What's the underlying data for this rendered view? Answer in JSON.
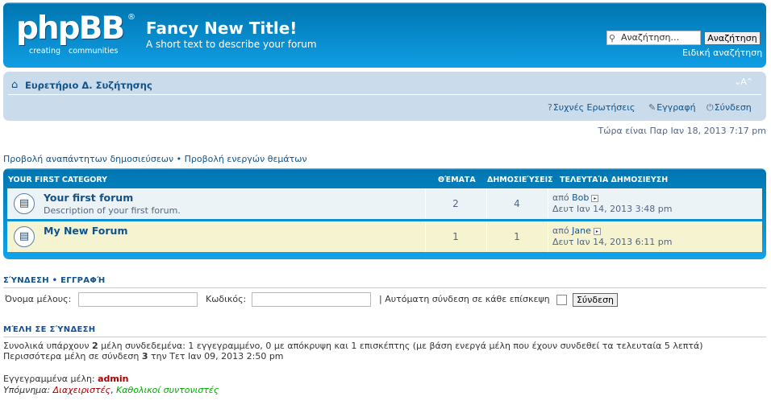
{
  "header": {
    "logo_word": "phpBB",
    "logo_reg": "®",
    "logo_tag_1": "creating",
    "logo_tag_2": "communities",
    "site_title": "Fancy New Title!",
    "site_description": "A short text to describe your forum",
    "search_placeholder": "Αναζήτηση…",
    "search_button": "Αναζήτηση",
    "advanced_search": "Ειδική αναζήτηση"
  },
  "navbar": {
    "breadcrumb": "Ευρετήριο Δ. Συζήτησης",
    "font_resize": "⌄A⌃",
    "faq": "Συχνές Ερωτήσεις",
    "register": "Εγγραφή",
    "login": "Σύνδεση"
  },
  "current_time": "Τώρα είναι Παρ Ιαν 18, 2013 7:17 pm",
  "quick_links": {
    "unanswered": "Προβολή αναπάντητων δημοσιεύσεων",
    "separator": "•",
    "active": "Προβολή ενεργών θεμάτων"
  },
  "forum_table": {
    "category": "YOUR FIRST CATEGORY",
    "col_topics": "ΘΈΜΑΤΑ",
    "col_posts": "ΔΗΜΟΣΙΕΎΣΕΙΣ",
    "col_last_post": "ΤΕΛΕΥΤΑΊΑ ΔΗΜΟΣΙΕΥΣΗ",
    "rows": [
      {
        "name": "Your first forum",
        "description": "Description of your first forum.",
        "topics": "2",
        "posts": "4",
        "last_by_prefix": "από ",
        "last_by": "Bob",
        "last_date": "Δευτ Ιαν 14, 2013 3:48 pm"
      },
      {
        "name": "My New Forum",
        "description": "",
        "topics": "1",
        "posts": "1",
        "last_by_prefix": "από ",
        "last_by": "Jane",
        "last_date": "Δευτ Ιαν 14, 2013 6:11 pm"
      }
    ]
  },
  "login_section": {
    "title": "ΣΎΝΔΕΣΗ",
    "separator": "•",
    "register_title": "ΕΓΓΡΑΦΉ",
    "username_label": "Όνομα μέλους:",
    "password_label": "Κωδικός:",
    "autologin_label": "| Αυτόματη σύνδεση σε κάθε επίσκεψη",
    "login_button": "Σύνδεση"
  },
  "online_section": {
    "title": "ΜΈΛΗ ΣΕ ΣΎΝΔΕΣΗ",
    "total_prefix": "Συνολικά υπάρχουν ",
    "total_count": "2",
    "total_suffix": " μέλη συνδεδεμένα: 1 εγγεγραμμένο, 0 με απόκρυψη και 1 επισκέπτης (με βάση ενεργά μέλη που έχουν συνδεθεί τα τελευταία 5 λεπτά)",
    "max_prefix": "Περισσότερα μέλη σε σύνδεση ",
    "max_count": "3",
    "max_suffix": " την Τετ Ιαν 09, 2013 2:50 pm",
    "registered_label": "Εγγεγραμμένα μέλη: ",
    "registered_user": "admin",
    "legend_label": "Υπόμνημα: ",
    "legend_admins": "Διαχειριστές",
    "legend_sep": ", ",
    "legend_mods": "Καθολικοί συντονιστές"
  }
}
